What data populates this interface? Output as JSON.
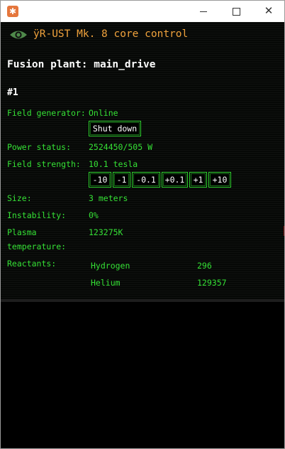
{
  "window": {
    "app_icon": "asterisk-icon",
    "controls": {
      "minimize": "minimize-icon",
      "maximize": "maximize-icon",
      "close_glyph": "✕"
    }
  },
  "header": {
    "icon": "eye-icon",
    "title": "ÿR-UST Mk. 8 core control"
  },
  "plant": {
    "title": "Fusion plant: main_drive",
    "unit_number": "#1"
  },
  "field_generator": {
    "label": "Field generator:",
    "status": "Online",
    "button_label": "Shut down"
  },
  "power": {
    "label": "Power status:",
    "value": "2524450/505 W"
  },
  "field_strength": {
    "label": "Field strength:",
    "value": "10.1 tesla",
    "buttons": [
      "-10",
      "-1",
      "-0.1",
      "+0.1",
      "+1",
      "+10"
    ]
  },
  "size": {
    "label": "Size:",
    "value": "3 meters"
  },
  "instability": {
    "label": "Instability:",
    "value": "0%"
  },
  "plasma": {
    "label_line1": "Plasma",
    "label_line2": "temperature:",
    "value": "123275K"
  },
  "reactants": {
    "label": "Reactants:",
    "items": [
      {
        "name": "Hydrogen",
        "amount": "296"
      },
      {
        "name": "Helium",
        "amount": "129357"
      }
    ]
  },
  "colors": {
    "accent_green": "#35e135",
    "header_orange": "#f0a23c",
    "background": "#060806"
  }
}
